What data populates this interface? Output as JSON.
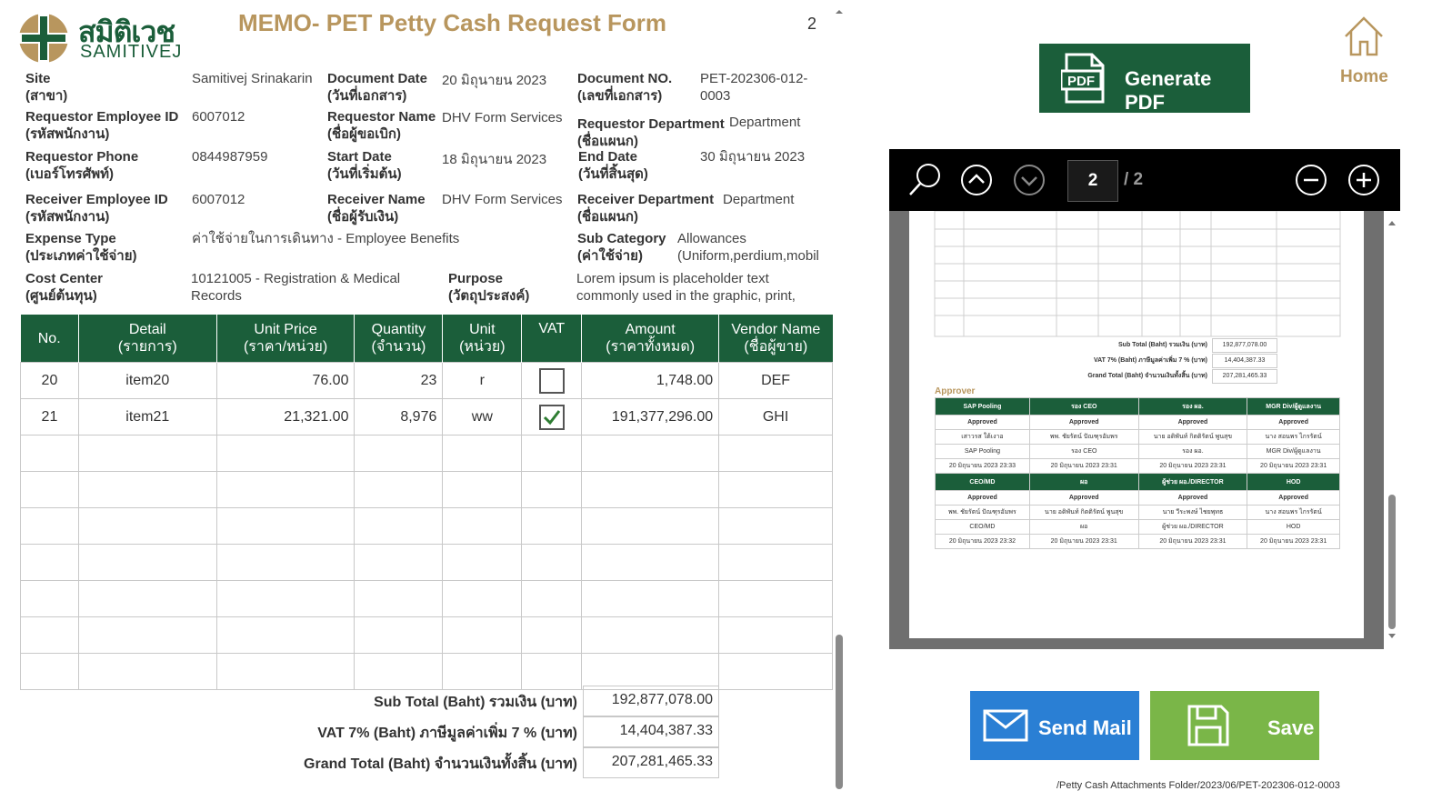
{
  "header": {
    "logo_thai": "สมิติเวช",
    "logo_eng": "SAMITIVEJ",
    "title": "MEMO- PET Petty Cash Request Form",
    "page_number": "2"
  },
  "fields": {
    "site": {
      "label": "Site",
      "label_th": "(สาขา)",
      "value": "Samitivej Srinakarin"
    },
    "document_date": {
      "label": "Document Date",
      "label_th": "(วันที่เอกสาร)",
      "value": "20 มิถุนายน 2023"
    },
    "document_no": {
      "label": "Document NO.",
      "label_th": "(เลขที่เอกสาร)",
      "value_line1": "PET-202306-012-",
      "value_line2": "0003"
    },
    "req_emp_id": {
      "label": "Requestor Employee ID",
      "label_th": "(รหัสพนักงาน)",
      "value": "6007012"
    },
    "req_name": {
      "label": "Requestor Name",
      "label_th": "(ชื่อผู้ขอเบิก)",
      "value": "DHV Form Services"
    },
    "req_dept": {
      "label": "Requestor Department",
      "label_th": "(ชื่อแผนก)",
      "value": "Department"
    },
    "req_phone": {
      "label": "Requestor Phone",
      "label_th": "(เบอร์โทรศัพท์)",
      "value": "0844987959"
    },
    "start_date": {
      "label": "Start Date",
      "label_th": "(วันที่เริ่มต้น)",
      "value": "18 มิถุนายน 2023"
    },
    "end_date": {
      "label": "End Date",
      "label_th": "(วันที่สิ้นสุด)",
      "value": "30 มิถุนายน 2023"
    },
    "rcv_emp_id": {
      "label": "Receiver Employee ID",
      "label_th": "(รหัสพนักงาน)",
      "value": "6007012"
    },
    "rcv_name": {
      "label": "Receiver Name",
      "label_th": "(ชื่อผู้รับเงิน)",
      "value": "DHV Form Services"
    },
    "rcv_dept": {
      "label": "Receiver Department",
      "label_th": "(ชื่อแผนก)",
      "value": "Department"
    },
    "expense_type": {
      "label": "Expense Type",
      "label_th": "(ประเภทค่าใช้จ่าย)",
      "value": "ค่าใช้จ่ายในการเดินทาง - Employee Benefits"
    },
    "sub_category": {
      "label": "Sub Category",
      "label_th": "(ค่าใช้จ่าย)",
      "value_line1": "Allowances",
      "value_line2": "(Uniform,perdium,mobil"
    },
    "cost_center": {
      "label": "Cost Center",
      "label_th": "(ศูนย์ต้นทุน)",
      "value_line1": "10121005 - Registration & Medical",
      "value_line2": "Records"
    },
    "purpose": {
      "label": "Purpose",
      "label_th": "(วัตถุประสงค์)",
      "value_line1": "Lorem ipsum is placeholder text",
      "value_line2": "commonly used in the graphic, print,"
    }
  },
  "items_table": {
    "headers": [
      {
        "en": "No.",
        "th": ""
      },
      {
        "en": "Detail",
        "th": "(รายการ)"
      },
      {
        "en": "Unit Price",
        "th": "(ราคา/หน่วย)"
      },
      {
        "en": "Quantity",
        "th": "(จำนวน)"
      },
      {
        "en": "Unit",
        "th": "(หน่วย)"
      },
      {
        "en": "VAT",
        "th": ""
      },
      {
        "en": "Amount",
        "th": "(ราคาทั้งหมด)"
      },
      {
        "en": "Vendor Name",
        "th": "(ชื่อผู้ขาย)"
      }
    ],
    "rows": [
      {
        "no": "20",
        "detail": "item20",
        "unit_price": "76.00",
        "quantity": "23",
        "unit": "r",
        "vat": false,
        "amount": "1,748.00",
        "vendor": "DEF"
      },
      {
        "no": "21",
        "detail": "item21",
        "unit_price": "21,321.00",
        "quantity": "8,976",
        "unit": "ww",
        "vat": true,
        "amount": "191,377,296.00",
        "vendor": "GHI"
      }
    ]
  },
  "totals": {
    "subtotal_label": "Sub Total (Baht) รวมเงิน (บาท)",
    "subtotal_value": "192,877,078.00",
    "vat_label": "VAT 7% (Baht) ภาษีมูลค่าเพิ่ม 7 % (บาท)",
    "vat_value": "14,404,387.33",
    "grand_label": "Grand Total (Baht) จำนวนเงินทั้งสิ้น (บาท)",
    "grand_value": "207,281,465.33"
  },
  "actions": {
    "generate_pdf": "Generate PDF",
    "home": "Home",
    "send_mail": "Send Mail",
    "save": "Save"
  },
  "viewer": {
    "current_page": "2",
    "total_pages": "/ 2",
    "mini_subtotal_label": "Sub Total (Baht) รวมเงิน (บาท)",
    "mini_subtotal": "192,877,078.00",
    "mini_vat_label": "VAT 7% (Baht) ภาษีมูลค่าเพิ่ม 7 % (บาท)",
    "mini_vat": "14,404,387.33",
    "mini_grand_label": "Grand Total (Baht) จำนวนเงินทั้งสิ้น (บาท)",
    "mini_grand": "207,281,465.33",
    "approver_title": "Approver",
    "approver_groups": [
      {
        "roles": [
          "SAP Pooling",
          "รอง CEO",
          "รอง ผอ.",
          "MGR Div/ผู้ดูแลงาน"
        ],
        "status": [
          "Approved",
          "Approved",
          "Approved",
          "Approved"
        ],
        "names": [
          "เสาวรส ใต้เงาอ",
          "พพ. ชัยรัตน์ ปัณฑุรอัมพร",
          "นาย อดิพันท์ กิตติรัตน์ พูนสุข",
          "นาง สอนพร ไกรรัตน์"
        ],
        "roles_again": [
          "SAP Pooling",
          "รอง CEO",
          "รอง ผอ.",
          "MGR Div/ผู้ดูแลงาน"
        ],
        "dates": [
          "20 มิถุนายน 2023 23:33",
          "20 มิถุนายน 2023 23:31",
          "20 มิถุนายน 2023 23:31",
          "20 มิถุนายน 2023 23:31"
        ]
      },
      {
        "roles": [
          "CEO/MD",
          "ผอ",
          "ผู้ช่วย ผอ./DIRECTOR",
          "HOD"
        ],
        "status": [
          "Approved",
          "Approved",
          "Approved",
          "Approved"
        ],
        "names": [
          "พพ. ชัยรัตน์ ปัณฑุรอัมพร",
          "นาย อดิพันท์ กิตติรัตน์ พูนสุข",
          "นาย วีระพงษ์ ไชยพุทธ",
          "นาง สอนพร ไกรรัตน์"
        ],
        "roles_again": [
          "CEO/MD",
          "ผอ",
          "ผู้ช่วย ผอ./DIRECTOR",
          "HOD"
        ],
        "dates": [
          "20 มิถุนายน 2023 23:32",
          "20 มิถุนายน 2023 23:31",
          "20 มิถุนายน 2023 23:31",
          "20 มิถุนายน 2023 23:31"
        ]
      }
    ]
  },
  "footer_path": "/Petty Cash Attachments Folder/2023/06/PET-202306-012-0003",
  "colors": {
    "brand_green": "#1b5e3a",
    "title_gold": "#b8965e",
    "mail_blue": "#2a7fd4",
    "save_green": "#7ab648"
  }
}
